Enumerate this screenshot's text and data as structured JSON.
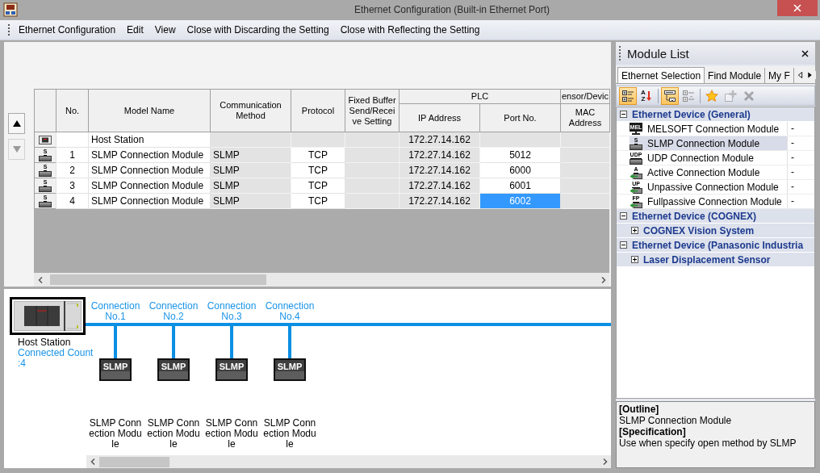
{
  "window": {
    "title": "Ethernet Configuration (Built-in Ethernet Port)"
  },
  "menu": [
    "Ethernet Configuration",
    "Edit",
    "View",
    "Close with Discarding the Setting",
    "Close with Reflecting the Setting"
  ],
  "order_buttons": [
    {
      "kind": "up",
      "disabled": false
    },
    {
      "kind": "down",
      "disabled": true
    }
  ],
  "table": {
    "columns": [
      {
        "label": "No."
      },
      {
        "label": "Model Name"
      },
      {
        "label": "Communication Method"
      },
      {
        "label": "Protocol"
      },
      {
        "label": "Fixed Buffer Send/Receive Setting"
      },
      {
        "label": "PLC",
        "colspan": 2,
        "children": [
          {
            "label": "IP Address"
          },
          {
            "label": "Port No."
          }
        ]
      },
      {
        "label": "ensor/Devic",
        "children": [
          {
            "label": "MAC Address"
          }
        ]
      }
    ],
    "rows": [
      {
        "kind": "host",
        "cells": [
          {
            "readonly": false,
            "selected": false
          },
          {
            "text": "Host Station",
            "readonly": false,
            "selected": false
          },
          {
            "readonly": true,
            "selected": false
          },
          {
            "readonly": true,
            "selected": false
          },
          {
            "readonly": true,
            "selected": false
          },
          {
            "text": "172.27.14.162",
            "readonly": true,
            "selected": false
          },
          {
            "readonly": true,
            "selected": false
          },
          {
            "readonly": true,
            "selected": false
          }
        ]
      },
      {
        "kind": "module",
        "badge": "S",
        "cells": [
          {
            "text": "1",
            "readonly": false,
            "selected": false
          },
          {
            "text": "SLMP Connection Module",
            "readonly": false,
            "selected": false
          },
          {
            "text": "SLMP",
            "readonly": true,
            "selected": false
          },
          {
            "text": "TCP",
            "readonly": false,
            "selected": false
          },
          {
            "readonly": true,
            "selected": false
          },
          {
            "text": "172.27.14.162",
            "readonly": true,
            "selected": false
          },
          {
            "text": "5012",
            "readonly": false,
            "selected": false
          },
          {
            "readonly": true,
            "selected": false
          }
        ]
      },
      {
        "kind": "module",
        "badge": "S",
        "cells": [
          {
            "text": "2",
            "readonly": false,
            "selected": false
          },
          {
            "text": "SLMP Connection Module",
            "readonly": false,
            "selected": false
          },
          {
            "text": "SLMP",
            "readonly": true,
            "selected": false
          },
          {
            "text": "TCP",
            "readonly": false,
            "selected": false
          },
          {
            "readonly": true,
            "selected": false
          },
          {
            "text": "172.27.14.162",
            "readonly": true,
            "selected": false
          },
          {
            "text": "6000",
            "readonly": false,
            "selected": false
          },
          {
            "readonly": true,
            "selected": false
          }
        ]
      },
      {
        "kind": "module",
        "badge": "S",
        "cells": [
          {
            "text": "3",
            "readonly": false,
            "selected": false
          },
          {
            "text": "SLMP Connection Module",
            "readonly": false,
            "selected": false
          },
          {
            "text": "SLMP",
            "readonly": true,
            "selected": false
          },
          {
            "text": "TCP",
            "readonly": false,
            "selected": false
          },
          {
            "readonly": true,
            "selected": false
          },
          {
            "text": "172.27.14.162",
            "readonly": true,
            "selected": false
          },
          {
            "text": "6001",
            "readonly": false,
            "selected": false
          },
          {
            "readonly": true,
            "selected": false
          }
        ]
      },
      {
        "kind": "module",
        "badge": "S",
        "cells": [
          {
            "text": "4",
            "readonly": false,
            "selected": false
          },
          {
            "text": "SLMP Connection Module",
            "readonly": false,
            "selected": false
          },
          {
            "text": "SLMP",
            "readonly": true,
            "selected": false
          },
          {
            "text": "TCP",
            "readonly": false,
            "selected": false
          },
          {
            "readonly": true,
            "selected": false
          },
          {
            "text": "172.27.14.162",
            "readonly": true,
            "selected": false
          },
          {
            "text": "6002",
            "readonly": false,
            "selected": true
          },
          {
            "readonly": true,
            "selected": false
          }
        ]
      }
    ]
  },
  "diagram": {
    "host": {
      "name": "Host Station",
      "count": "Connected Count :4"
    },
    "connections": [
      {
        "label": "Connection No.1",
        "device": "SLMP",
        "module": "SLMP Connection Module"
      },
      {
        "label": "Connection No.2",
        "device": "SLMP",
        "module": "SLMP Connection Module"
      },
      {
        "label": "Connection No.3",
        "device": "SLMP",
        "module": "SLMP Connection Module"
      },
      {
        "label": "Connection No.4",
        "device": "SLMP",
        "module": "SLMP Connection Module"
      }
    ]
  },
  "module_list": {
    "title": "Module List",
    "tabs": [
      {
        "label": "Ethernet Selection",
        "selected": true
      },
      {
        "label": "Find Module",
        "selected": false
      },
      {
        "label": "My F",
        "selected": false
      }
    ],
    "toolbar": [
      [
        {
          "kind": "category-view",
          "pressed": true,
          "disabled": false
        },
        {
          "kind": "sort",
          "letters": [
            "A",
            "Z"
          ],
          "pressed": false,
          "disabled": false
        }
      ],
      [
        {
          "kind": "expand-all",
          "pressed": true,
          "disabled": false
        },
        {
          "kind": "collapse-all",
          "pressed": false,
          "disabled": false
        }
      ],
      [
        {
          "kind": "favorite",
          "pressed": false,
          "disabled": false
        },
        {
          "kind": "add",
          "pressed": false,
          "disabled": true
        },
        {
          "kind": "delete",
          "pressed": false,
          "disabled": true
        }
      ]
    ],
    "tree": [
      {
        "kind": "group",
        "label": "Ethernet Device (General)",
        "expanded": true,
        "selected": false,
        "children": [
          {
            "kind": "monitor",
            "badge": "MEL",
            "label": "MELSOFT Connection Module",
            "value": "-",
            "selected": false
          },
          {
            "kind": "module",
            "badge": "S",
            "label": "SLMP Connection Module",
            "value": "-",
            "selected": true
          },
          {
            "kind": "module",
            "badge": "UDP",
            "label": "UDP Connection Module",
            "value": "-",
            "selected": false
          },
          {
            "kind": "link",
            "badge": "A",
            "label": "Active Connection Module",
            "value": "-",
            "selected": false
          },
          {
            "kind": "link",
            "badge": "UP",
            "label": "Unpassive Connection Module",
            "value": "-",
            "selected": false
          },
          {
            "kind": "link",
            "badge": "FP",
            "label": "Fullpassive Connection Module",
            "value": "-",
            "selected": false
          }
        ]
      },
      {
        "kind": "group",
        "label": "Ethernet Device (COGNEX)",
        "expanded": true,
        "selected": false,
        "children": [
          {
            "kind": "category",
            "label": "COGNEX Vision System",
            "expanded": false,
            "selected": false
          }
        ]
      },
      {
        "kind": "group",
        "label": "Ethernet Device (Panasonic Industria",
        "expanded": true,
        "selected": false,
        "children": [
          {
            "kind": "category",
            "label": "Laser Displacement Sensor",
            "expanded": false,
            "selected": false
          }
        ]
      }
    ],
    "description": [
      {
        "kind": "heading",
        "text": "[Outline]"
      },
      {
        "kind": "body",
        "text": "SLMP Connection Module"
      },
      {
        "kind": "heading",
        "text": "[Specification]"
      },
      {
        "kind": "body",
        "text": "Use when specify open method by SLMP"
      }
    ]
  }
}
